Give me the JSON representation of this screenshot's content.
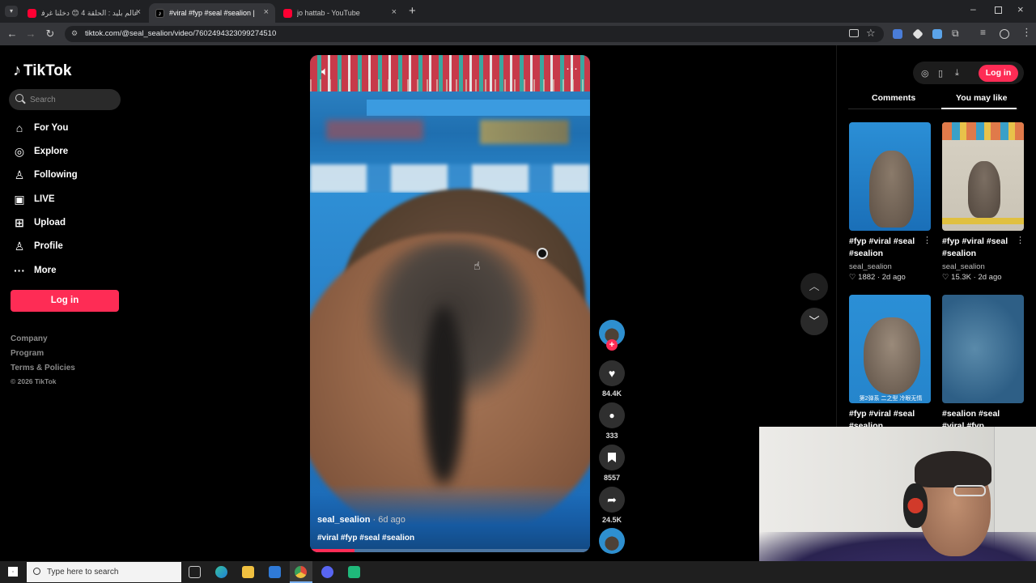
{
  "browser": {
    "tabs": [
      {
        "title": "عالم بليد : الحلقة 4 😊 دخلنا غرفة",
        "favicon_color": "#ff0033"
      },
      {
        "title": "#viral #fyp #seal #sealion | TikTok",
        "favicon_color": "#111111"
      },
      {
        "title": "jo hattab - YouTube",
        "favicon_color": "#ff0033"
      }
    ],
    "new_tab_icon": "plus-icon",
    "url": "tiktok.com/@seal_sealion/video/7602494323099274510",
    "window_controls": [
      "minimize-icon",
      "restore-icon",
      "close-icon"
    ]
  },
  "sidebar": {
    "logo": "TikTok",
    "search_placeholder": "Search",
    "items": [
      {
        "label": "For You",
        "icon": "home-icon"
      },
      {
        "label": "Explore",
        "icon": "compass-icon"
      },
      {
        "label": "Following",
        "icon": "person-icon"
      },
      {
        "label": "LIVE",
        "icon": "live-tv-icon"
      },
      {
        "label": "Upload",
        "icon": "plus-square-icon"
      },
      {
        "label": "Profile",
        "icon": "profile-icon"
      },
      {
        "label": "More",
        "icon": "ellipsis-icon"
      }
    ],
    "login_label": "Log in",
    "footer": [
      "Company",
      "Program",
      "Terms & Policies"
    ],
    "copyright": "© 2026 TikTok"
  },
  "video": {
    "username": "seal_sealion",
    "age": "· 6d ago",
    "hashtags": "#viral #fyp #seal #sealion",
    "progress_fraction": 0.16,
    "likes": "84.4K",
    "comments": "333",
    "saves": "8557",
    "shares": "24.5K"
  },
  "right_panel": {
    "tabs": [
      "Comments",
      "You may like"
    ],
    "active_tab": "You may like",
    "login_label": "Log in",
    "cards": [
      {
        "title": "#fyp #viral #seal #sealion",
        "user": "seal_sealion",
        "likes": "1882",
        "age": "2d ago"
      },
      {
        "title": "#fyp #viral #seal #sealion",
        "user": "seal_sealion",
        "likes": "15.3K",
        "age": "2d ago"
      },
      {
        "title": "#fyp #viral #seal #sealion",
        "thumb_text": "第2弹系 二之型 冷眼无情"
      },
      {
        "title": "#sealion #seal #viral #fyp"
      }
    ]
  },
  "taskbar": {
    "search_placeholder": "Type here to search"
  },
  "colors": {
    "accent": "#fe2c55",
    "background": "#000000"
  }
}
